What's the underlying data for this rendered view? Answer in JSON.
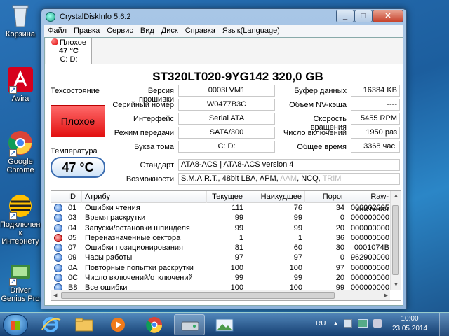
{
  "desktop": {
    "icons": [
      {
        "label": "Корзина"
      },
      {
        "label": "Avira"
      },
      {
        "label": "Google Chrome"
      },
      {
        "label": "Подключение к Интернету"
      },
      {
        "label": "Driver Genius Pro"
      }
    ]
  },
  "window": {
    "title": "CrystalDiskInfo 5.6.2",
    "menu": [
      "Файл",
      "Правка",
      "Сервис",
      "Вид",
      "Диск",
      "Справка",
      "Язык(Language)"
    ],
    "drive_tab": {
      "status": "Плохое",
      "temp": "47 °C",
      "letter": "C: D:"
    },
    "model": "ST320LT020-9YG142  320,0 GB",
    "health": {
      "label": "Техсостояние",
      "value": "Плохое"
    },
    "temperature": {
      "label": "Температура",
      "value": "47 °C"
    },
    "left_fields": [
      {
        "label": "Версия прошивки",
        "value": "0003LVM1"
      },
      {
        "label": "Серийный номер",
        "value": "W0477B3C"
      },
      {
        "label": "Интерфейс",
        "value": "Serial ATA"
      },
      {
        "label": "Режим передачи",
        "value": "SATA/300"
      },
      {
        "label": "Буква тома",
        "value": "C: D:"
      }
    ],
    "right_fields": [
      {
        "label": "Буфер данных",
        "value": "16384 KB"
      },
      {
        "label": "Объем NV-кэша",
        "value": "----"
      },
      {
        "label": "Скорость вращения",
        "value": "5455 RPM"
      },
      {
        "label": "Число включений",
        "value": "1950 раз"
      },
      {
        "label": "Общее время",
        "value": "3368 час."
      }
    ],
    "standard": {
      "label": "Стандарт",
      "value": "ATA8-ACS | ATA8-ACS version 4"
    },
    "features": {
      "label": "Возможности",
      "active": "S.M.A.R.T., 48bit LBA, APM, ",
      "inactive1": "AAM",
      "mid": ", NCQ, ",
      "inactive2": "TRIM"
    },
    "smart": {
      "columns": [
        "ID",
        "Атрибут",
        "Текущее",
        "Наихудшее",
        "Порог",
        "Raw-значения"
      ],
      "rows": [
        {
          "status": "good",
          "id": "01",
          "attr": "Ошибки чтения",
          "cur": "111",
          "worst": "76",
          "thr": "34",
          "raw": "000002095"
        },
        {
          "status": "good",
          "id": "03",
          "attr": "Время раскрутки",
          "cur": "99",
          "worst": "99",
          "thr": "0",
          "raw": "000000000"
        },
        {
          "status": "good",
          "id": "04",
          "attr": "Запуски/остановки шпинделя",
          "cur": "99",
          "worst": "99",
          "thr": "20",
          "raw": "000000000"
        },
        {
          "status": "bad",
          "id": "05",
          "attr": "Переназначенные сектора",
          "cur": "1",
          "worst": "1",
          "thr": "36",
          "raw": "000000000"
        },
        {
          "status": "good",
          "id": "07",
          "attr": "Ошибки позиционирования",
          "cur": "81",
          "worst": "60",
          "thr": "30",
          "raw": "0001074B"
        },
        {
          "status": "good",
          "id": "09",
          "attr": "Часы работы",
          "cur": "97",
          "worst": "97",
          "thr": "0",
          "raw": "962900000"
        },
        {
          "status": "good",
          "id": "0A",
          "attr": "Повторные попытки раскрутки",
          "cur": "100",
          "worst": "100",
          "thr": "97",
          "raw": "000000000"
        },
        {
          "status": "good",
          "id": "0C",
          "attr": "Число включений/отключений",
          "cur": "99",
          "worst": "99",
          "thr": "20",
          "raw": "000000000"
        },
        {
          "status": "good",
          "id": "B8",
          "attr": "Все ошибки",
          "cur": "100",
          "worst": "100",
          "thr": "99",
          "raw": "000000000"
        }
      ]
    }
  },
  "taskbar": {
    "lang": "RU",
    "time": "10:00",
    "date": "23.05.2014"
  },
  "colors": {
    "bad": "#e21010",
    "good": "#2a6fd6",
    "accent": "#1c5e9e"
  }
}
